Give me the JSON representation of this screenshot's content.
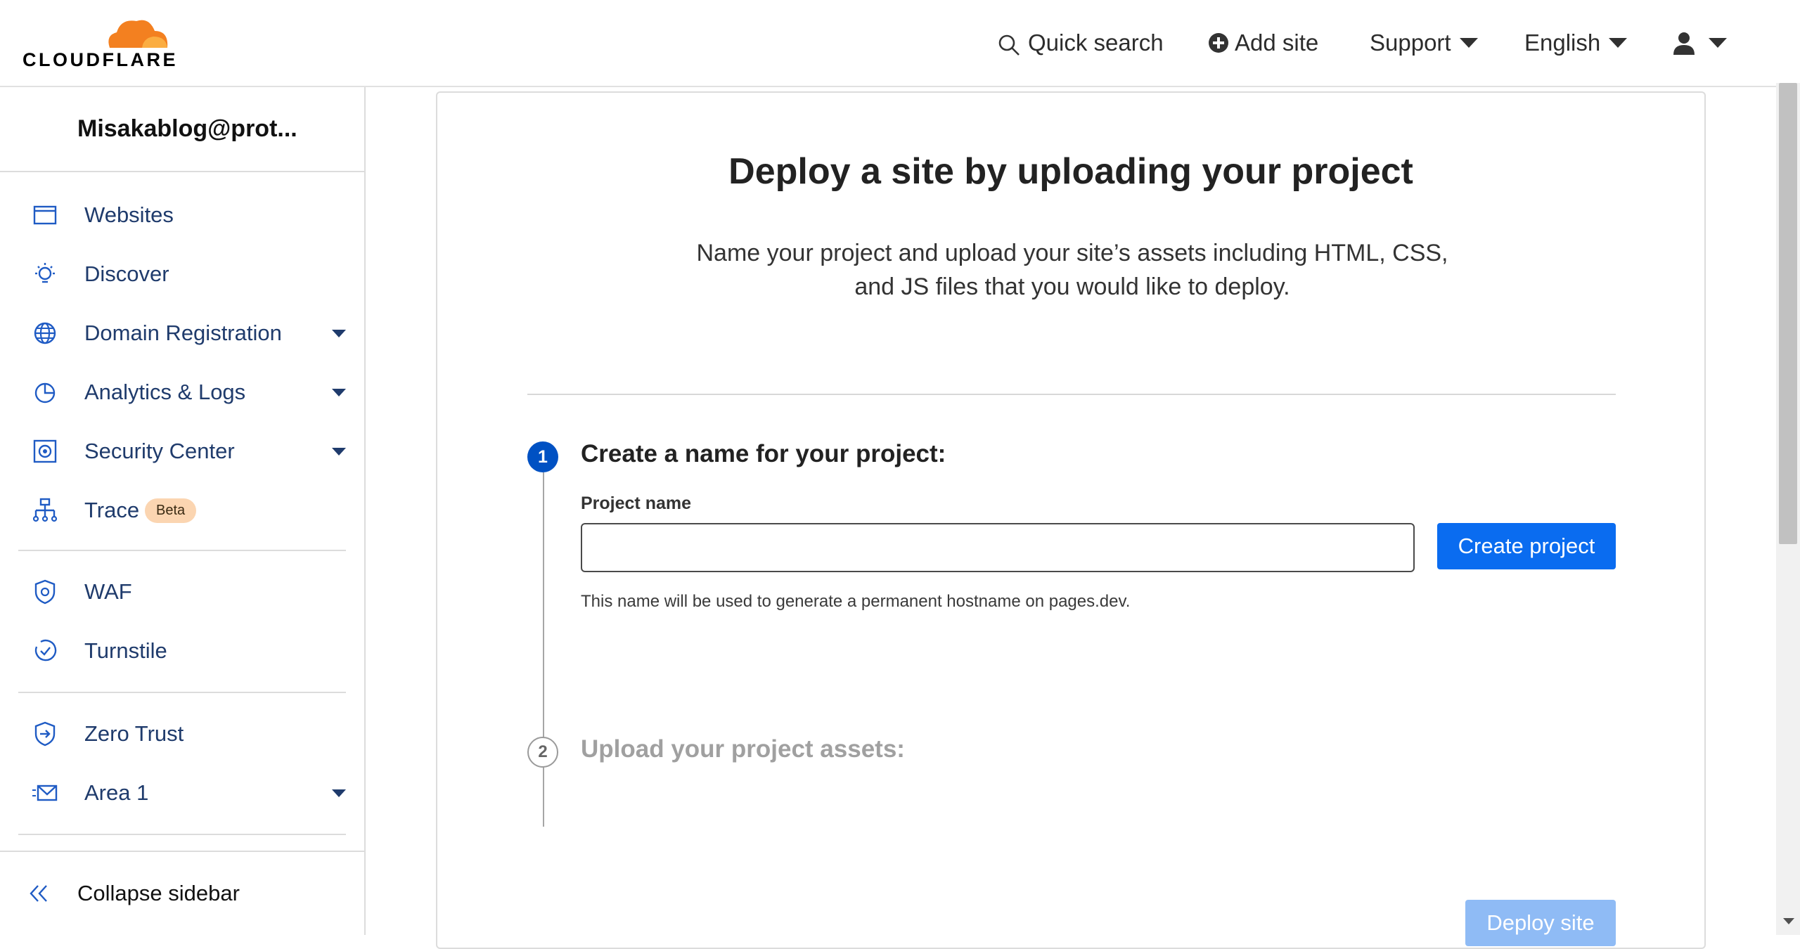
{
  "brand": {
    "logo_text": "CLOUDFLARE",
    "cloud_color": "#f38020"
  },
  "topnav": {
    "quick_search": "Quick search",
    "add_site": "Add site",
    "support": "Support",
    "language": "English"
  },
  "sidebar": {
    "account": "Misakablog@prot...",
    "items": [
      {
        "label": "Websites",
        "icon": "browser-window-icon"
      },
      {
        "label": "Discover",
        "icon": "lightbulb-icon"
      },
      {
        "label": "Domain Registration",
        "icon": "globe-icon"
      },
      {
        "label": "Analytics & Logs",
        "icon": "pie-chart-icon"
      },
      {
        "label": "Security Center",
        "icon": "security-center-icon"
      },
      {
        "label": "Trace",
        "icon": "trace-icon",
        "badge": "Beta"
      },
      {
        "label": "WAF",
        "icon": "waf-shield-icon"
      },
      {
        "label": "Turnstile",
        "icon": "turnstile-icon"
      },
      {
        "label": "Zero Trust",
        "icon": "zero-trust-icon"
      },
      {
        "label": "Area 1",
        "icon": "envelope-icon"
      }
    ],
    "collapse_label": "Collapse sidebar"
  },
  "main": {
    "heading": "Deploy a site by uploading your project",
    "subtext": "Name your project and upload your site’s assets including HTML, CSS, and JS files that you would like to deploy.",
    "step1": {
      "number": "1",
      "title": "Create a name for your project:",
      "field_label": "Project name",
      "field_value": "",
      "button": "Create project",
      "hint": "This name will be used to generate a permanent hostname on pages.dev."
    },
    "step2": {
      "number": "2",
      "title": "Upload your project assets:"
    },
    "deploy_button": "Deploy site"
  },
  "colors": {
    "primary": "#0a6cf0",
    "primary_disabled": "#8fbbf5",
    "nav_text": "#1f3b6c"
  }
}
